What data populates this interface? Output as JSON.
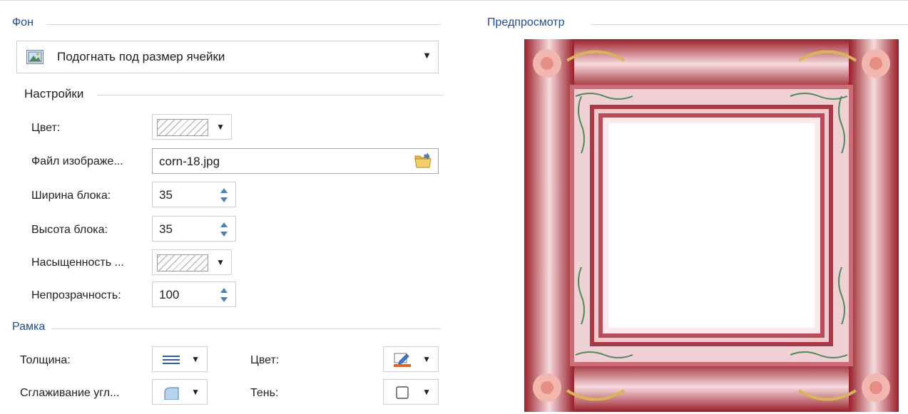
{
  "background": {
    "title": "Фон",
    "fit_mode": "Подогнать под размер ячейки"
  },
  "settings": {
    "title": "Настройки",
    "color_label": "Цвет:",
    "image_file_label": "Файл изображе...",
    "image_file_value": "corn-18.jpg",
    "block_width_label": "Ширина блока:",
    "block_width_value": "35",
    "block_height_label": "Высота блока:",
    "block_height_value": "35",
    "saturation_label": "Насыщенность ...",
    "opacity_label": "Непрозрачность:",
    "opacity_value": "100"
  },
  "border": {
    "title": "Рамка",
    "thickness_label": "Толщина:",
    "color_label": "Цвет:",
    "corner_smoothing_label": "Сглаживание угл...",
    "shadow_label": "Тень:"
  },
  "preview": {
    "title": "Предпросмотр"
  },
  "icons": {
    "fit": "fit-to-cell-icon",
    "folder": "folder-open-icon",
    "thickness": "line-thickness-icon",
    "pen_color": "pen-color-icon",
    "corner": "rounded-corner-icon",
    "shadow": "shadow-box-icon",
    "dropdown": "chevron-down-icon",
    "spin": "spin-arrows-icon"
  },
  "colors": {
    "group_title": "#1e4e8c",
    "frame_dark": "#9a1f2a",
    "frame_light": "#f6dadd"
  }
}
